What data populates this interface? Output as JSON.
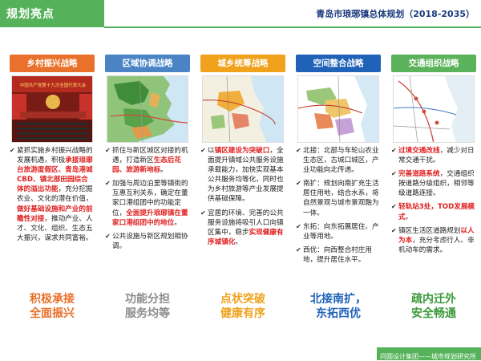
{
  "header": {
    "section_title": "规划亮点",
    "doc_title": "青岛市琅琊镇总体规划（2018-2035）"
  },
  "colors": {
    "brand_green": "#55b25a",
    "col1": "#e9712b",
    "col2": "#4a84c4",
    "col3": "#f0a21c",
    "col4": "#1f62b8",
    "col5": "#5ab25a",
    "highlight_red": "#e02020"
  },
  "columns": [
    {
      "title": "乡村振兴战略",
      "image_caption": "中国共产党第十九次全国代表大会",
      "bullets": [
        {
          "parts": [
            {
              "t": "紧抓实施乡村振兴战略的发展机遇，积极"
            },
            {
              "t": "承接琅琊台旅游度假区、青岛港城CBD、镇北部田园综合体的溢出功能",
              "hl": true
            },
            {
              "t": "，充分挖掘农业、文化的潜在价值，"
            },
            {
              "t": "做好基础设施和产业的前瞻性对接",
              "hl": true
            },
            {
              "t": "，推动产业、人才、文化、组织、生态五大振兴，谋求共同富裕。"
            }
          ]
        }
      ],
      "bottom": [
        "积极承接",
        "全面振兴"
      ],
      "bottom_color": "#e9712b"
    },
    {
      "title": "区域协调战略",
      "bullets": [
        {
          "parts": [
            {
              "t": "抓住与新区城区对接的机遇，打造新区"
            },
            {
              "t": "生态后花园、旅游新地标",
              "hl": true
            },
            {
              "t": "。"
            }
          ]
        },
        {
          "parts": [
            {
              "t": "加强与周边泊里等镇街的互惠互利关系，确定在董家口港组团中的功能定位，"
            },
            {
              "t": "全面提升琅琊镇在董家口港组团中的地位",
              "hl": true
            },
            {
              "t": "。"
            }
          ]
        },
        {
          "parts": [
            {
              "t": "公共设施与新区规划相协调。"
            }
          ]
        }
      ],
      "bottom": [
        "功能分担",
        "服务均等"
      ],
      "bottom_color": "#8c8c8c"
    },
    {
      "title": "城乡统筹战略",
      "bullets": [
        {
          "parts": [
            {
              "t": "以"
            },
            {
              "t": "镇区建设为突破口",
              "hl": true
            },
            {
              "t": "，全面提升镇域公共服务设施承载能力，加快实现基本公共服务均等化，同时也为乡村旅游等产业发展提供基础保障。"
            }
          ]
        },
        {
          "parts": [
            {
              "t": "宜居的环境、完善的公共服务设施将吸引人口向镇区集中，稳步"
            },
            {
              "t": "实现健康有序城镇化",
              "hl": true
            },
            {
              "t": "。"
            }
          ]
        }
      ],
      "bottom": [
        "点状突破",
        "健康有序"
      ],
      "bottom_color": "#f0a21c"
    },
    {
      "title": "空间整合战略",
      "bullets": [
        {
          "parts": [
            {
              "t": "北接：北部与车轮山农业生态区，古城口城区，产业功能向北传递。"
            }
          ]
        },
        {
          "parts": [
            {
              "t": "南扩：规划向南扩充生活居住用地，结合水系，将自然景观与城市景观融为一体。"
            }
          ]
        },
        {
          "parts": [
            {
              "t": "东拓：向东拓展居住、产业等用地。"
            }
          ]
        },
        {
          "parts": [
            {
              "t": "西优：向西整合村庄用地，提升居住水平。"
            }
          ]
        }
      ],
      "bottom": [
        "北接南扩，",
        "东拓西优"
      ],
      "bottom_color": "#1f62b8"
    },
    {
      "title": "交通组织战略",
      "bullets": [
        {
          "parts": [
            {
              "t": "过境交通改线",
              "hl": true
            },
            {
              "t": "，减少对日常交通干扰。"
            }
          ]
        },
        {
          "parts": [
            {
              "t": "完善道路系统",
              "hl": true
            },
            {
              "t": "，交通组织按道路分级组织，相邻等级道路连接。"
            }
          ]
        },
        {
          "parts": [
            {
              "t": "轻轨站3处，TOD发展模式",
              "hl": true
            },
            {
              "t": "。"
            }
          ]
        },
        {
          "parts": [
            {
              "t": "镇区生活区道路规划"
            },
            {
              "t": "以人为本",
              "hl": true
            },
            {
              "t": "，充分考虑行人、非机动车的需求。"
            }
          ]
        }
      ],
      "bottom": [
        "疏内迁外",
        "安全畅通"
      ],
      "bottom_color": "#3a9a3a"
    }
  ],
  "footer": {
    "text": "问圆设计集团——城市规划研究所"
  }
}
